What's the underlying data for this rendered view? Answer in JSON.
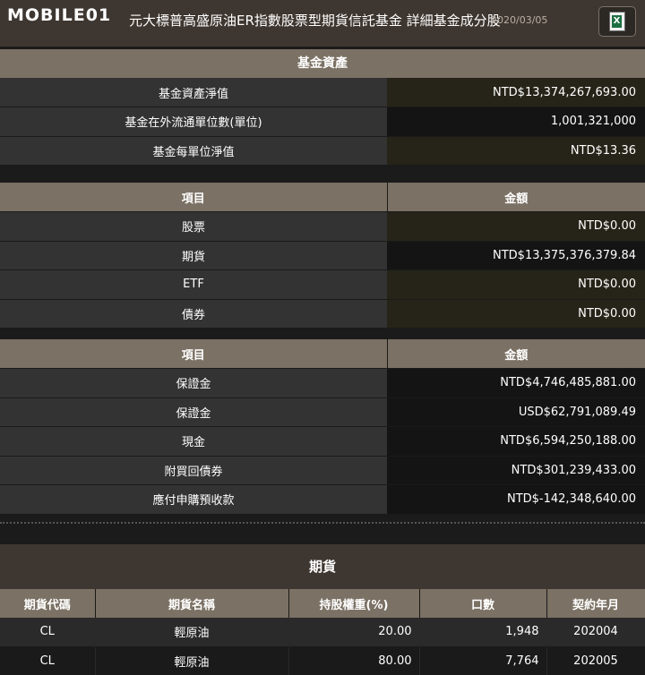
{
  "header": {
    "logo": "MOBILE01",
    "title": "元大標普高盛原油ER指數股票型期貨信託基金 詳細基金成分股",
    "date": "2020/03/05",
    "excel_icon": "excel-icon"
  },
  "assets": {
    "title": "基金資產",
    "rows": [
      {
        "label": "基金資產淨值",
        "value": "NTD$13,374,267,693.00"
      },
      {
        "label": "基金在外流通單位數(單位)",
        "value": "1,001,321,000"
      },
      {
        "label": "基金每單位淨值",
        "value": "NTD$13.36"
      }
    ]
  },
  "holdings": {
    "col_item": "項目",
    "col_amount": "金額",
    "rows": [
      {
        "label": "股票",
        "value": "NTD$0.00"
      },
      {
        "label": "期貨",
        "value": "NTD$13,375,376,379.84"
      },
      {
        "label": "ETF",
        "value": "NTD$0.00"
      },
      {
        "label": "債券",
        "value": "NTD$0.00"
      }
    ]
  },
  "cash": {
    "col_item": "項目",
    "col_amount": "金額",
    "rows": [
      {
        "label": "保證金",
        "value": "NTD$4,746,485,881.00"
      },
      {
        "label": "保證金",
        "value": "USD$62,791,089.49"
      },
      {
        "label": "現金",
        "value": "NTD$6,594,250,188.00"
      },
      {
        "label": "附買回債券",
        "value": "NTD$301,239,433.00"
      },
      {
        "label": "應付申購預收款",
        "value": "NTD$-142,348,640.00"
      }
    ]
  },
  "futures": {
    "title": "期貨",
    "columns": [
      "期貨代碼",
      "期貨名稱",
      "持股權重(%)",
      "口數",
      "契約年月"
    ],
    "rows": [
      {
        "code": "CL",
        "name": "輕原油",
        "weight": "20.00",
        "lots": "1,948",
        "month": "202004"
      },
      {
        "code": "CL",
        "name": "輕原油",
        "weight": "80.00",
        "lots": "7,764",
        "month": "202005"
      }
    ]
  },
  "colors": {
    "header_bg": "#3e3630",
    "section_bg": "#7b7164",
    "label_bg": "#333333",
    "value_olive": "#262418",
    "value_dark": "#141414"
  }
}
